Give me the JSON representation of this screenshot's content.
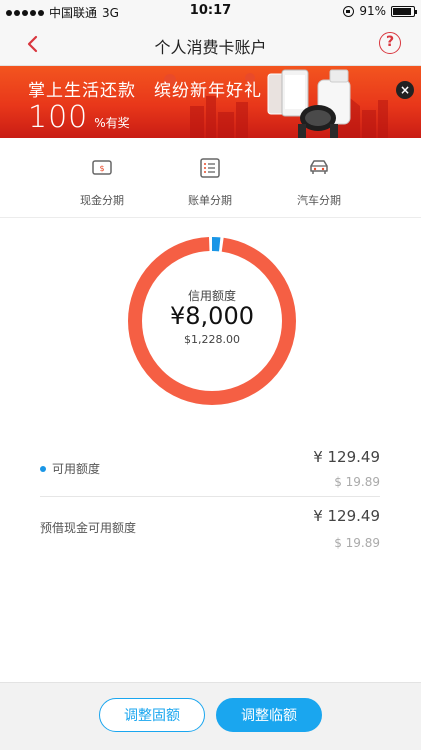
{
  "status_bar": {
    "carrier": "中国联通",
    "network": "3G",
    "time": "10:17",
    "battery": "91%",
    "battery_level": 0.91
  },
  "nav": {
    "title": "个人消费卡账户",
    "back_icon": "chevron-left-icon",
    "help_icon": "question-circle-icon",
    "help_glyph": "?"
  },
  "banner": {
    "line1": "掌上生活还款　缤纷新年好礼",
    "number": "100",
    "suffix": "%有奖",
    "close_glyph": "×"
  },
  "menu": {
    "items": [
      {
        "label": "现金分期",
        "icon": "cash-icon"
      },
      {
        "label": "账单分期",
        "icon": "bill-list-icon"
      },
      {
        "label": "汽车分期",
        "icon": "car-icon"
      }
    ]
  },
  "credit": {
    "label": "信用额度",
    "amount": "¥8,000",
    "usd": "$1,228.00",
    "used_fraction": 0.016,
    "ring_color": "#f55f44",
    "used_color": "#1a96e6"
  },
  "rows": [
    {
      "label": "可用额度",
      "amount": "¥ 129.49",
      "usd": "$ 19.89",
      "dot": true
    },
    {
      "label": "预借现金可用额度",
      "amount": "¥ 129.49",
      "usd": "$ 19.89",
      "dot": false
    }
  ],
  "buttons": {
    "fixed": "调整固额",
    "temp": "调整临额"
  },
  "colors": {
    "accent": "#1aa6ef",
    "nav_red": "#d9363e"
  }
}
